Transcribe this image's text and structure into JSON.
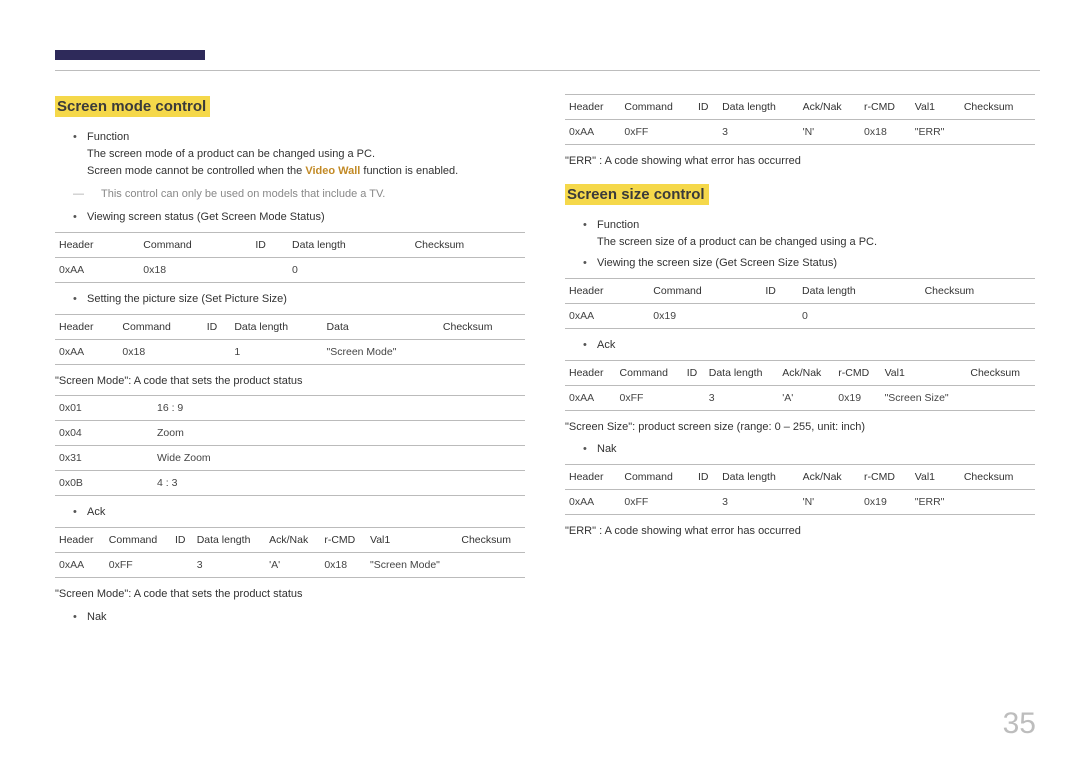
{
  "page_number": "35",
  "left": {
    "title": "Screen mode control",
    "bullets": {
      "function_label": "Function",
      "function_line1": "The screen mode of a product can be changed using a PC.",
      "function_line2_pre": "Screen mode cannot be controlled when the ",
      "function_line2_accent": "Video Wall",
      "function_line2_post": " function is enabled.",
      "note": "This control can only be used on models that include a TV.",
      "viewing": "Viewing screen status (Get Screen Mode Status)",
      "setting": "Setting the picture size (Set Picture Size)",
      "ack": "Ack",
      "nak": "Nak"
    },
    "table1": {
      "h": [
        "Header",
        "Command",
        "ID",
        "Data length",
        "Checksum"
      ],
      "r": [
        "0xAA",
        "0x18",
        "",
        "0",
        ""
      ]
    },
    "table2": {
      "h": [
        "Header",
        "Command",
        "ID",
        "Data length",
        "Data",
        "Checksum"
      ],
      "r": [
        "0xAA",
        "0x18",
        "",
        "1",
        "\"Screen Mode\"",
        ""
      ]
    },
    "caption_codes": "\"Screen Mode\": A code that sets the product status",
    "codes": [
      [
        "0x01",
        "16 : 9"
      ],
      [
        "0x04",
        "Zoom"
      ],
      [
        "0x31",
        "Wide Zoom"
      ],
      [
        "0x0B",
        "4 : 3"
      ]
    ],
    "table_ack": {
      "h": [
        "Header",
        "Command",
        "ID",
        "Data length",
        "Ack/Nak",
        "r-CMD",
        "Val1",
        "Checksum"
      ],
      "r": [
        "0xAA",
        "0xFF",
        "",
        "3",
        "'A'",
        "0x18",
        "\"Screen Mode\"",
        ""
      ]
    },
    "caption_codes2": "\"Screen Mode\": A code that sets the product status"
  },
  "right": {
    "table_nak": {
      "h": [
        "Header",
        "Command",
        "ID",
        "Data length",
        "Ack/Nak",
        "r-CMD",
        "Val1",
        "Checksum"
      ],
      "r": [
        "0xAA",
        "0xFF",
        "",
        "3",
        "'N'",
        "0x18",
        "\"ERR\"",
        ""
      ]
    },
    "err_caption": "\"ERR\" : A code showing what error has occurred",
    "title": "Screen size control",
    "bullets": {
      "function_label": "Function",
      "function_line1": "The screen size of a product can be changed using a PC.",
      "viewing": "Viewing the screen size (Get Screen Size Status)",
      "ack": "Ack",
      "nak": "Nak"
    },
    "table_get": {
      "h": [
        "Header",
        "Command",
        "ID",
        "Data length",
        "Checksum"
      ],
      "r": [
        "0xAA",
        "0x19",
        "",
        "0",
        ""
      ]
    },
    "table_ack": {
      "h": [
        "Header",
        "Command",
        "ID",
        "Data length",
        "Ack/Nak",
        "r-CMD",
        "Val1",
        "Checksum"
      ],
      "r": [
        "0xAA",
        "0xFF",
        "",
        "3",
        "'A'",
        "0x19",
        "\"Screen Size\"",
        ""
      ]
    },
    "size_caption": "\"Screen Size\": product screen size (range: 0 – 255, unit: inch)",
    "table_nak2": {
      "h": [
        "Header",
        "Command",
        "ID",
        "Data length",
        "Ack/Nak",
        "r-CMD",
        "Val1",
        "Checksum"
      ],
      "r": [
        "0xAA",
        "0xFF",
        "",
        "3",
        "'N'",
        "0x19",
        "\"ERR\"",
        ""
      ]
    },
    "err_caption2": "\"ERR\" : A code showing what error has occurred"
  }
}
